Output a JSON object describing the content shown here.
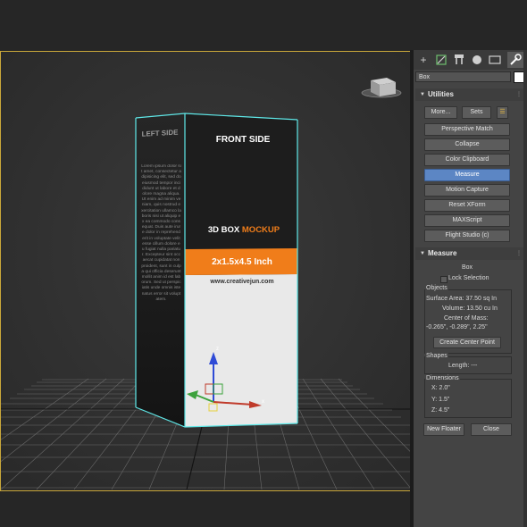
{
  "name_field": "Box",
  "utilities": {
    "title": "Utilities",
    "more_label": "More...",
    "sets_label": "Sets",
    "buttons": [
      "Perspective Match",
      "Collapse",
      "Color Clipboard",
      "Measure",
      "Motion Capture",
      "Reset XForm",
      "MAXScript",
      "Flight Studio (c)"
    ],
    "active_button": "Measure"
  },
  "measure": {
    "title": "Measure",
    "object_name": "Box",
    "lock_selection_label": "Lock Selection",
    "objects_title": "Objects",
    "surface_area": "Surface Area: 37.50 sq In",
    "volume": "Volume: 13.50 cu In",
    "center_of_mass_label": "Center of Mass:",
    "center_of_mass_value": "-0.265\", -0.289\", 2.25\"",
    "create_center_point_label": "Create Center Point",
    "shapes_title": "Shapes",
    "length": "Length: ---",
    "dimensions_title": "Dimensions",
    "dim_x": "X:  2.0\"",
    "dim_y": "Y:  1.5\"",
    "dim_z": "Z:  4.5\"",
    "new_floater_label": "New Floater",
    "close_label": "Close"
  },
  "box_mockup": {
    "left_side_title": "LEFT SIDE",
    "front_side_title": "FRONT SIDE",
    "mockup_title_white": "3D BOX ",
    "mockup_title_orange": "MOCKUP",
    "size_label": "2x1.5x4.5 Inch",
    "website": "www.creativejun.com",
    "left_side_text": "Lorem ipsum dolor sit amet, consectetur adipisicing elit, sed do eiusmod tempor incididunt ut labore et dolore magna aliqua. Ut enim ad minim veniam, quis nostrud exercitation ullamco laboris nisi ut aliquip ex ea commodo consequat. Duis aute irure dolor in reprehenderit in voluptate velit esse cillum dolore eu fugiat nulla pariatur. Excepteur sint occaecat cupidatat non proident, sunt in culpa qui officia deserunt mollit anim id est laborum. Sed ut perspiciatis unde omnis iste natus error sit voluptatem."
  },
  "gizmo": {
    "z_label": "z",
    "x_label": "x"
  },
  "colors": {
    "accent_orange": "#f07d1a",
    "selection_cyan": "#5fe8e8",
    "viewport_border": "#c9a73a",
    "active_button": "#5c86c4"
  }
}
